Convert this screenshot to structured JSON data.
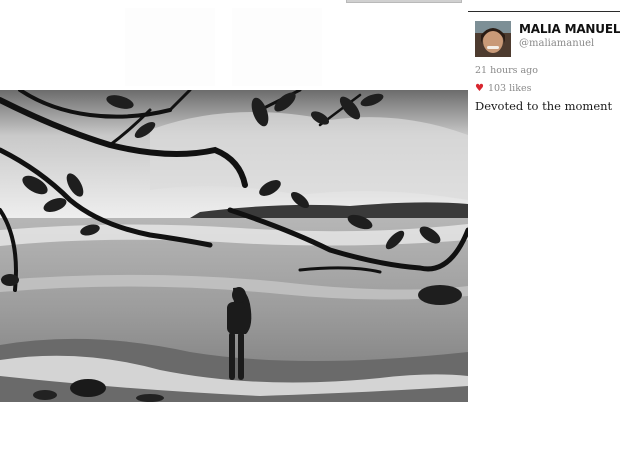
{
  "post": {
    "display_name": "MALIA MANUEL",
    "handle": "@maliamanuel",
    "timestamp": "21 hours ago",
    "likes_text": "103 likes",
    "caption": "Devoted to the moment"
  },
  "icons": {
    "like": "heart-icon"
  },
  "colors": {
    "heart": "#d8262f",
    "sidebar_rule": "#2b2b2b",
    "meta_text": "#8a8a8a"
  }
}
